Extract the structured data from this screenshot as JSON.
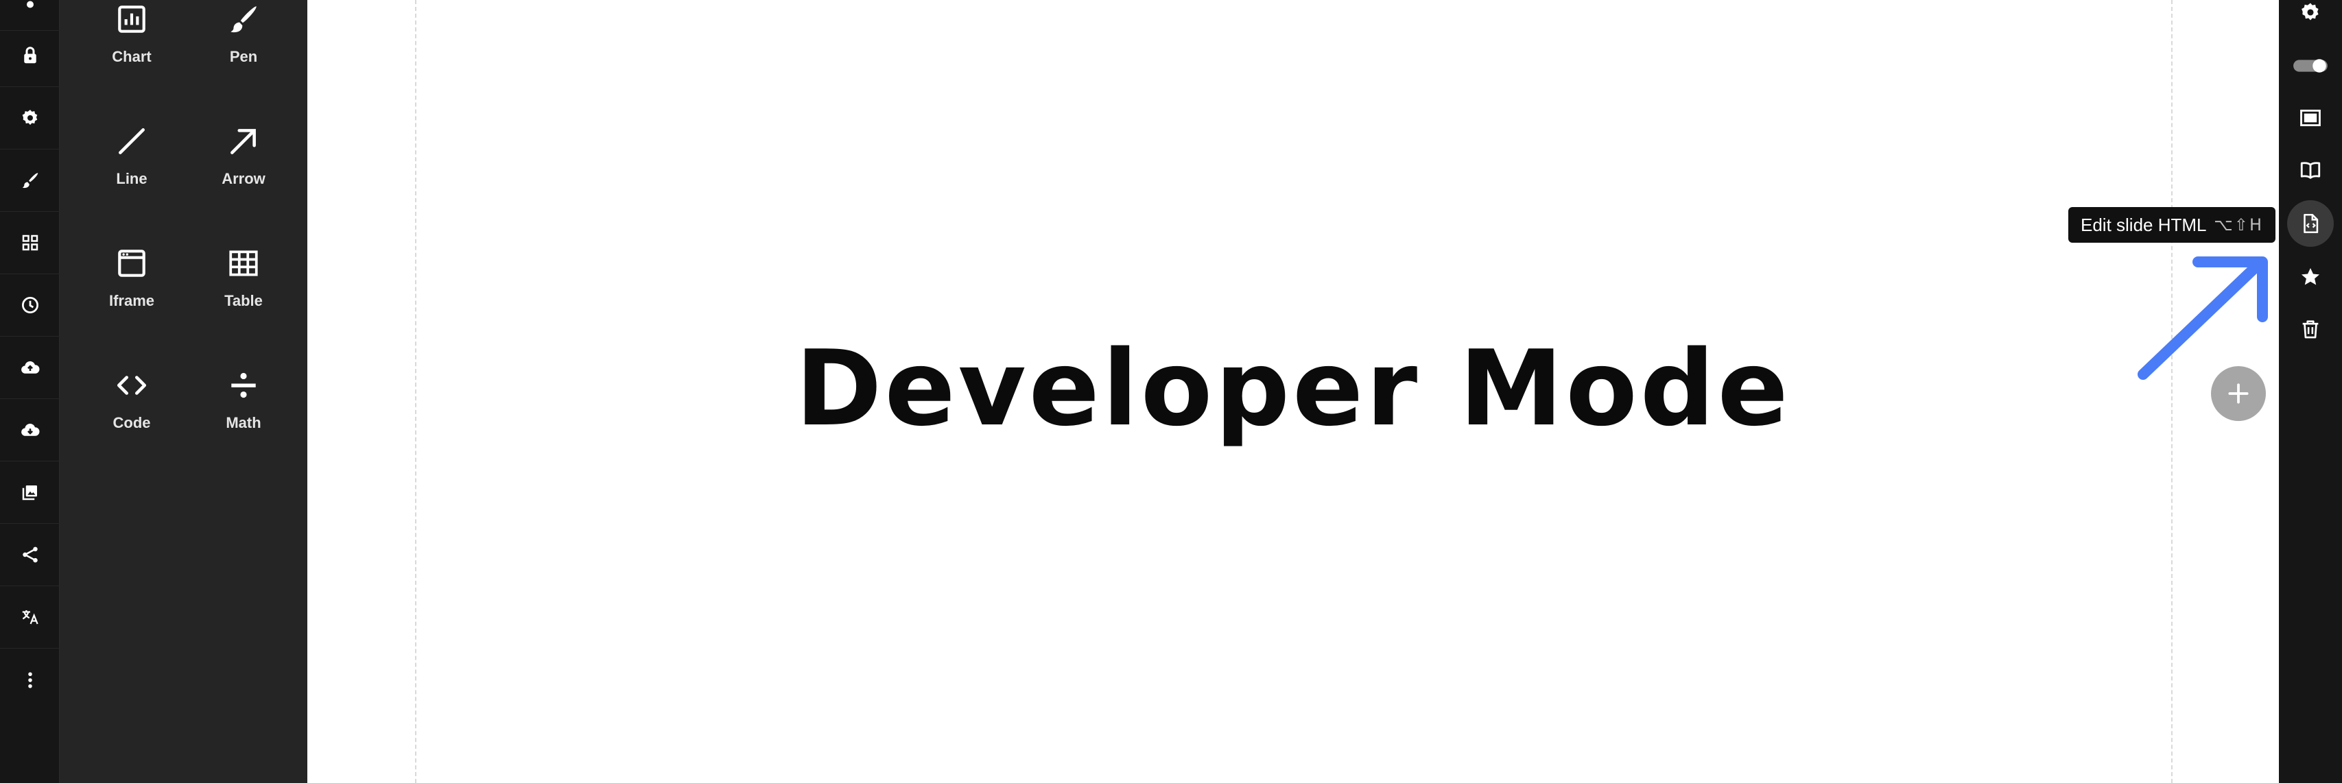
{
  "left_rail": {
    "items": [
      {
        "name": "more-top",
        "icon": "partial-icon"
      },
      {
        "name": "lock",
        "icon": "lock-icon"
      },
      {
        "name": "settings",
        "icon": "gear-icon"
      },
      {
        "name": "brush",
        "icon": "brush-icon"
      },
      {
        "name": "grid",
        "icon": "grid-icon"
      },
      {
        "name": "history",
        "icon": "clock-icon"
      },
      {
        "name": "upload",
        "icon": "cloud-upload-icon"
      },
      {
        "name": "download",
        "icon": "cloud-download-icon"
      },
      {
        "name": "media",
        "icon": "images-icon"
      },
      {
        "name": "share",
        "icon": "share-icon"
      },
      {
        "name": "translate",
        "icon": "translate-icon"
      },
      {
        "name": "more",
        "icon": "more-vertical-icon"
      }
    ]
  },
  "palette": {
    "tools": [
      {
        "label": "Chart",
        "icon": "chart-icon"
      },
      {
        "label": "Pen",
        "icon": "pen-icon"
      },
      {
        "label": "Line",
        "icon": "line-icon"
      },
      {
        "label": "Arrow",
        "icon": "arrow-icon"
      },
      {
        "label": "Iframe",
        "icon": "iframe-icon"
      },
      {
        "label": "Table",
        "icon": "table-icon"
      },
      {
        "label": "Code",
        "icon": "code-icon"
      },
      {
        "label": "Math",
        "icon": "divide-icon"
      }
    ]
  },
  "slide": {
    "title": "Developer Mode"
  },
  "right_rail": {
    "items": [
      {
        "name": "settings",
        "icon": "gear-icon"
      },
      {
        "name": "toggle",
        "icon": "toggle-icon"
      },
      {
        "name": "frame",
        "icon": "frame-icon"
      },
      {
        "name": "notes",
        "icon": "book-icon"
      },
      {
        "name": "edit-html",
        "icon": "code-file-icon",
        "active": true
      },
      {
        "name": "favorite",
        "icon": "star-icon"
      },
      {
        "name": "delete",
        "icon": "trash-icon"
      }
    ]
  },
  "tooltip": {
    "text": "Edit slide HTML",
    "shortcut": "⌥⇧H"
  },
  "colors": {
    "rail_bg": "#161616",
    "palette_bg": "#252526",
    "accent_arrow": "#4a7cf7",
    "add_button": "#a6a6a6"
  }
}
